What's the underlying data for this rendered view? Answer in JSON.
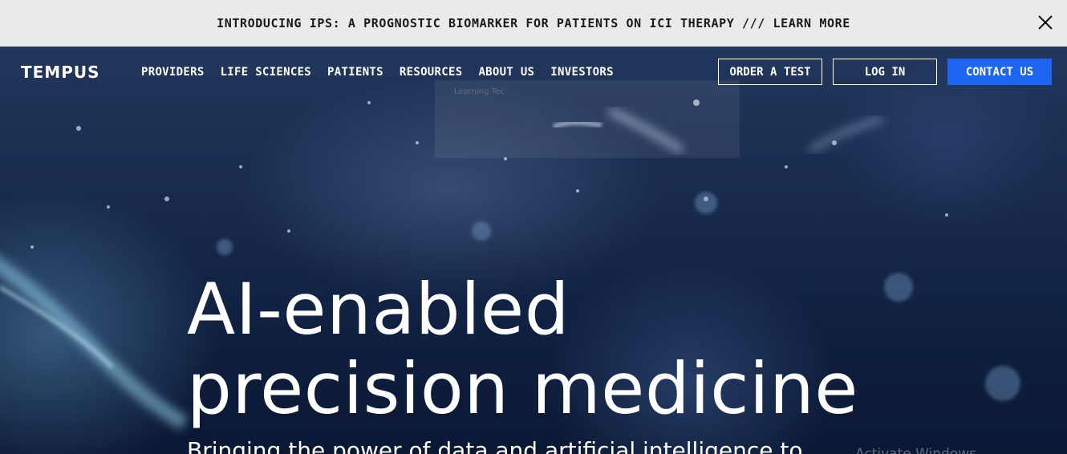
{
  "announcement": {
    "text": "INTRODUCING IPS: A PROGNOSTIC BIOMARKER FOR PATIENTS ON ICI THERAPY /// LEARN MORE",
    "close_icon": "close-icon"
  },
  "nav": {
    "logo": "TEMPUS",
    "links": [
      "PROVIDERS",
      "LIFE SCIENCES",
      "PATIENTS",
      "RESOURCES",
      "ABOUT US",
      "INVESTORS"
    ],
    "order_test": "ORDER A TEST",
    "login": "LOG IN",
    "contact": "CONTACT US"
  },
  "dropdown_ghost_text": "Learning Tec",
  "hero": {
    "headline_line1": "AI-enabled",
    "headline_line2": "precision medicine",
    "subheadline": "Bringing the power of data and artificial intelligence to",
    "windows_watermark": "Activate Windows"
  },
  "colors": {
    "announcement_bg": "#e9eaec",
    "hero_bg": "#172a4c",
    "contact_button": "#1c66f2",
    "text_light": "#ffffff"
  }
}
